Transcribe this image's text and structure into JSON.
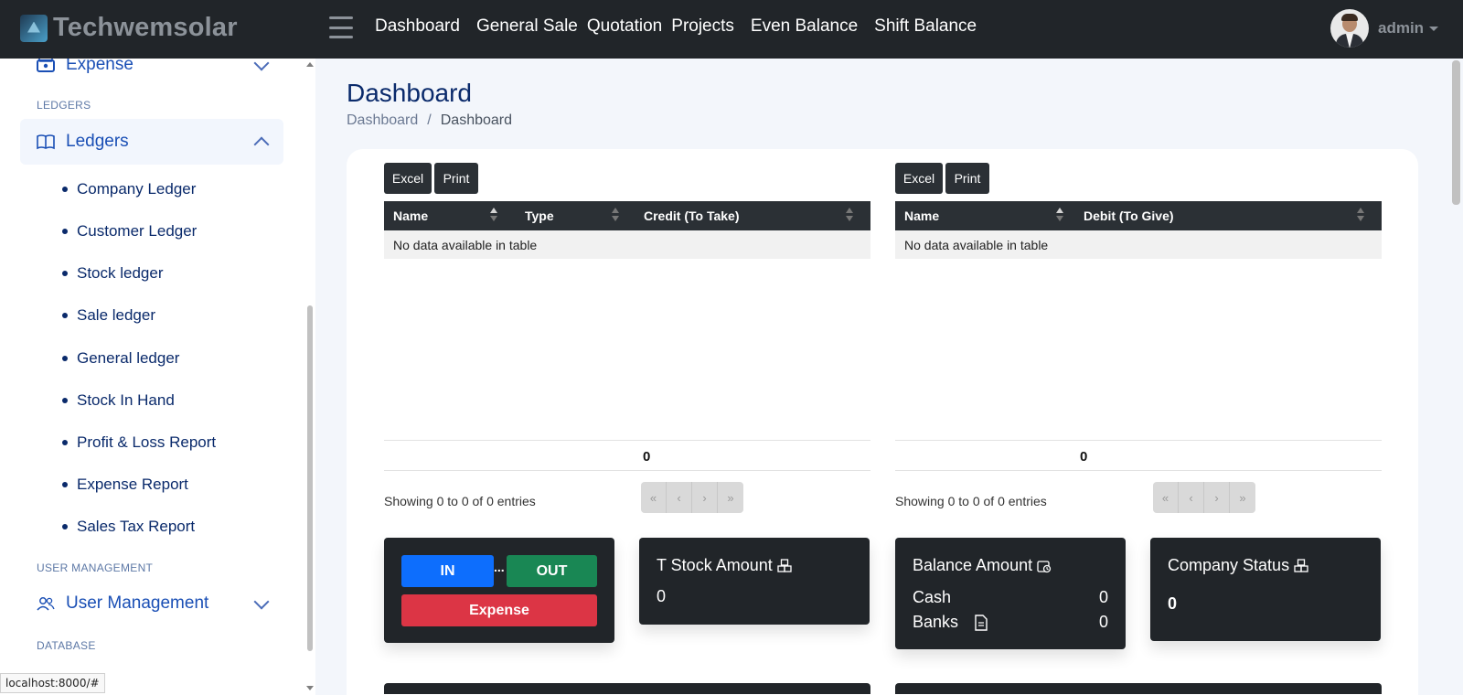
{
  "brand": {
    "name": "Techwemsolar"
  },
  "topnav": [
    "Dashboard",
    "General Sale",
    "Quotation",
    "Projects",
    "Even Balance",
    "Shift Balance"
  ],
  "user": {
    "name": "admin"
  },
  "sidebar": {
    "expense": {
      "label": "Expense"
    },
    "ledgers_heading": "LEDGERS",
    "ledgers": {
      "label": "Ledgers"
    },
    "ledger_items": [
      "Company Ledger",
      "Customer Ledger",
      "Stock ledger",
      "Sale ledger",
      "General ledger",
      "Stock In Hand",
      "Profit & Loss Report",
      "Expense Report",
      "Sales Tax Report"
    ],
    "user_mgmt_heading": "USER MANAGEMENT",
    "user_mgmt": {
      "label": "User Management"
    },
    "database_heading": "DATABASE"
  },
  "page": {
    "title": "Dashboard",
    "breadcrumb": [
      "Dashboard",
      "Dashboard"
    ]
  },
  "tables": {
    "excel_label": "Excel",
    "print_label": "Print",
    "credit": {
      "columns": [
        "Name",
        "Type",
        "Credit (To Take)"
      ],
      "empty": "No data available in table",
      "total": "0",
      "showing": "Showing 0 to 0 of 0 entries"
    },
    "debit": {
      "columns": [
        "Name",
        "Debit (To Give)"
      ],
      "empty": "No data available in table",
      "total": "0",
      "showing": "Showing 0 to 0 of 0 entries"
    },
    "pager": [
      "«",
      "‹",
      "›",
      "»"
    ]
  },
  "tiles": {
    "actions": {
      "in": "IN",
      "separator": "...",
      "out": "OUT",
      "expense": "Expense"
    },
    "stock": {
      "title": "T Stock Amount",
      "value": "0"
    },
    "balance": {
      "title": "Balance Amount",
      "cash_label": "Cash",
      "cash_value": "0",
      "banks_label": "Banks",
      "banks_value": "0"
    },
    "company": {
      "title": "Company Status",
      "value": "0"
    }
  },
  "status_bar": {
    "url": "localhost:8000/#"
  },
  "colors": {
    "topbar": "#212529",
    "accent": "#1a4fb5",
    "in": "#0d6efd",
    "out": "#198754",
    "expense": "#dc3545"
  }
}
